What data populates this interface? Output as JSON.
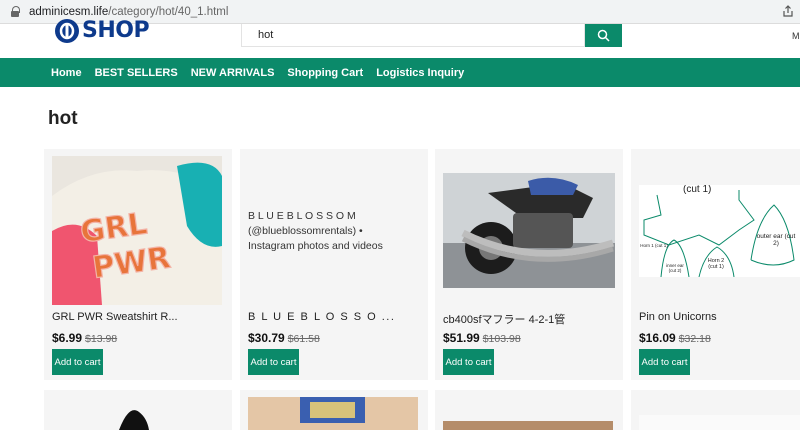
{
  "browser": {
    "url_host": "adminicesm.life",
    "url_path": "/category/hot/40_1.html"
  },
  "header": {
    "logo_text": "SHOP",
    "search_value": "hot",
    "right_text": "M"
  },
  "nav": {
    "items": [
      "Home",
      "BEST SELLERS",
      "NEW ARRIVALS",
      "Shopping Cart",
      "Logistics Inquiry"
    ]
  },
  "page": {
    "title": "hot"
  },
  "products": [
    {
      "name": "GRL PWR Sweatshirt R...",
      "price": "$6.99",
      "old_price": "$13.98",
      "button": "Add to cart"
    },
    {
      "name": "B L U E B L O S S O ...",
      "price": "$30.79",
      "old_price": "$61.58",
      "button": "Add to cart",
      "image_alt": "B L U E B L O S S O M (@blueblossomrentals) • Instagram photos and videos"
    },
    {
      "name": "cb400sfマフラー 4-2-1管",
      "price": "$51.99",
      "old_price": "$103.98",
      "button": "Add to cart"
    },
    {
      "name": "Pin on Unicorns",
      "price": "$16.09",
      "old_price": "$32.18",
      "button": "Add to cart",
      "image_labels": [
        "(cut 1)",
        "outer ear (cut 2)",
        "inner ear (cut 2)",
        "Horn 2 (cut 1)",
        "Horn 1 (cut 1)"
      ]
    }
  ],
  "colors": {
    "accent": "#0b8a6a",
    "brand": "#0e3a8c"
  }
}
